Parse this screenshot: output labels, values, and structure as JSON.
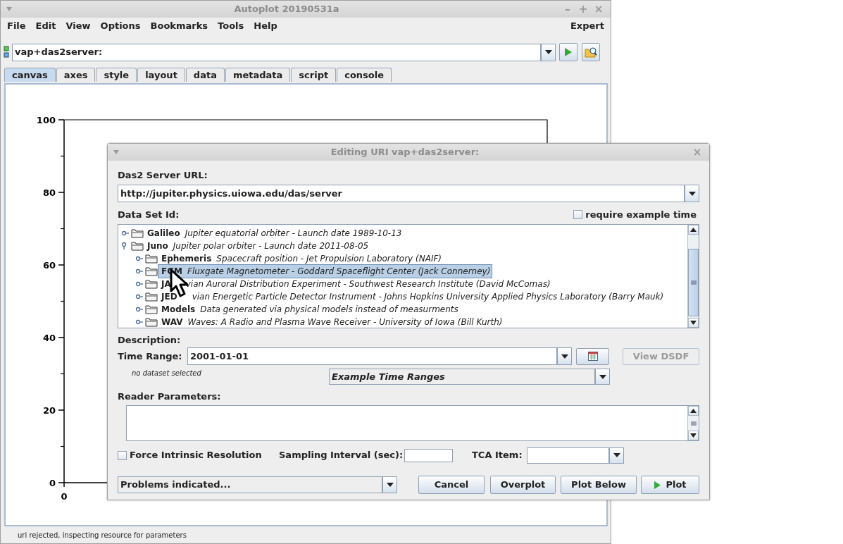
{
  "window": {
    "title": "Autoplot 20190531a",
    "controls": [
      "–",
      "+",
      "×"
    ]
  },
  "menu": [
    "File",
    "Edit",
    "View",
    "Options",
    "Bookmarks",
    "Tools",
    "Help"
  ],
  "menu_right": "Expert",
  "uri_field": {
    "value": "vap+das2server:"
  },
  "tabs": [
    {
      "label": "canvas",
      "selected": true
    },
    {
      "label": "axes",
      "selected": false
    },
    {
      "label": "style",
      "selected": false
    },
    {
      "label": "layout",
      "selected": false
    },
    {
      "label": "data",
      "selected": false
    },
    {
      "label": "metadata",
      "selected": false
    },
    {
      "label": "script",
      "selected": false
    },
    {
      "label": "console",
      "selected": false
    }
  ],
  "plot": {
    "y_tick_labels": [
      "100",
      "80",
      "60",
      "40",
      "20",
      "0"
    ],
    "x_tick_labels": [
      "0"
    ]
  },
  "status_bar": "uri rejected, inspecting resource for parameters",
  "dialog": {
    "title": "Editing URI vap+das2server:",
    "close": "×",
    "server_label": "Das2 Server URL:",
    "server_url": "http://jupiter.physics.uiowa.edu/das/server",
    "dataset_label": "Data Set Id:",
    "require_example_time": {
      "label": "require example time",
      "checked": false
    },
    "tree": [
      {
        "name": "Galileo",
        "description": "Jupiter equatorial orbiter - Launch date 1989-10-13",
        "expanded": false,
        "selected": false
      },
      {
        "name": "Juno",
        "description": "Jupiter polar orbiter - Launch date 2011-08-05",
        "expanded": true,
        "selected": false,
        "children": [
          {
            "name": "Ephemeris",
            "description": "Spacecraft position - Jet Propulsion Laboratory (NAIF)",
            "expanded": false,
            "selected": false
          },
          {
            "name": "FGM",
            "description": "Fluxgate Magnetometer - Goddard Spaceflight Center (Jack Connerney)",
            "expanded": false,
            "selected": true
          },
          {
            "name": "JA",
            "description": "vian Auroral Distribution Experiment - Southwest Research Institute (David McComas)",
            "expanded": false,
            "selected": false,
            "covered": true
          },
          {
            "name": "JED",
            "description": "vian Energetic Particle Detector Instrument - Johns Hopkins University Applied Physics Laboratory (Barry Mauk)",
            "expanded": false,
            "selected": false,
            "covered": true
          },
          {
            "name": "Models",
            "description": "Data generated via physical models instead of measurments",
            "expanded": false,
            "selected": false
          },
          {
            "name": "WAV",
            "description": "Waves: A Radio and Plasma Wave Receiver - University of Iowa (Bill Kurth)",
            "expanded": false,
            "selected": false
          }
        ]
      }
    ],
    "description_label": "Description:",
    "time_range_label": "Time Range:",
    "time_range": "2001-01-01",
    "view_dsdf": {
      "label": "View DSDF",
      "disabled": true
    },
    "dataset_note": "no dataset selected",
    "example_time_ranges": "Example Time Ranges",
    "reader_params_label": "Reader Parameters:",
    "force_intrinsic": {
      "label": "Force Intrinsic Resolution",
      "checked": false
    },
    "sampling_label": "Sampling Interval (sec):",
    "tca_label": "TCA Item:",
    "problems": "Problems indicated...",
    "buttons": [
      {
        "label": "Cancel",
        "kind": "plain"
      },
      {
        "label": "Overplot",
        "kind": "plain"
      },
      {
        "label": "Plot Below",
        "kind": "plain"
      },
      {
        "label": "Plot",
        "kind": "play"
      }
    ]
  }
}
